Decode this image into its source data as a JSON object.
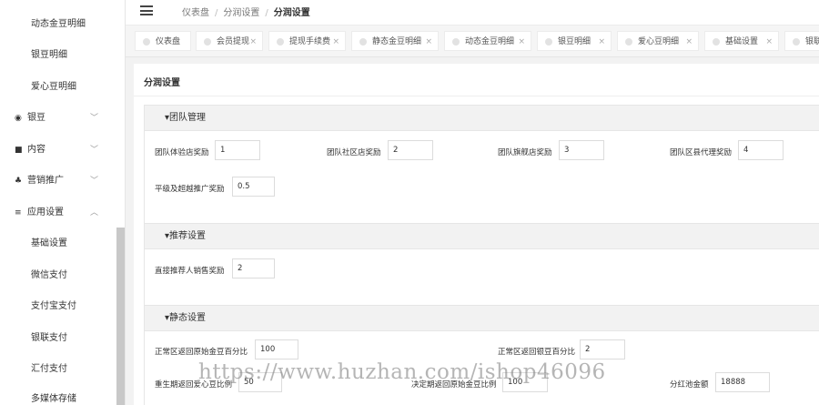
{
  "sidebar": {
    "items": [
      {
        "label": "动态金豆明细"
      },
      {
        "label": "银豆明细"
      },
      {
        "label": "爱心豆明细"
      }
    ],
    "groups": [
      {
        "label": "银豆",
        "icon": "radio-icon"
      },
      {
        "label": "内容",
        "icon": "folder-icon"
      },
      {
        "label": "营销推广",
        "icon": "share-icon"
      },
      {
        "label": "应用设置",
        "icon": "list-icon"
      }
    ],
    "sub_items": [
      {
        "label": "基础设置"
      },
      {
        "label": "微信支付"
      },
      {
        "label": "支付宝支付"
      },
      {
        "label": "银联支付"
      },
      {
        "label": "汇付支付"
      },
      {
        "label": "多媒体存储"
      }
    ]
  },
  "header": {
    "breadcrumb": [
      "仪表盘",
      "分润设置",
      "分润设置"
    ]
  },
  "tabs": [
    {
      "label": "仪表盘"
    },
    {
      "label": "会员提现"
    },
    {
      "label": "提现手续费"
    },
    {
      "label": "静态金豆明细"
    },
    {
      "label": "动态金豆明细"
    },
    {
      "label": "银豆明细"
    },
    {
      "label": "爱心豆明细"
    },
    {
      "label": "基础设置"
    },
    {
      "label": "银联"
    }
  ],
  "main": {
    "title": "分润设置",
    "sections": [
      {
        "title": "▾团队管理",
        "fields": [
          {
            "label": "团队体验店奖励",
            "value": "1"
          },
          {
            "label": "团队社区店奖励",
            "value": "2"
          },
          {
            "label": "团队旗舰店奖励",
            "value": "3"
          },
          {
            "label": "团队区县代理奖励",
            "value": "4"
          },
          {
            "label": "平级及超越推广奖励",
            "value": "0.5"
          }
        ]
      },
      {
        "title": "▾推荐设置",
        "fields": [
          {
            "label": "直接推荐人销售奖励",
            "value": "2"
          }
        ]
      },
      {
        "title": "▾静态设置",
        "fields": [
          {
            "label": "正常区返回原始金豆百分比",
            "value": "100"
          },
          {
            "label": "正常区返回银豆百分比",
            "value": "2"
          },
          {
            "label": "重生期返回爱心豆比例",
            "value": "50"
          },
          {
            "label": "决定期返回原始金豆比例",
            "value": "100"
          },
          {
            "label": "分红池金额",
            "value": "18888"
          }
        ]
      }
    ]
  },
  "watermark": "https://www.huzhan.com/ishop46096"
}
